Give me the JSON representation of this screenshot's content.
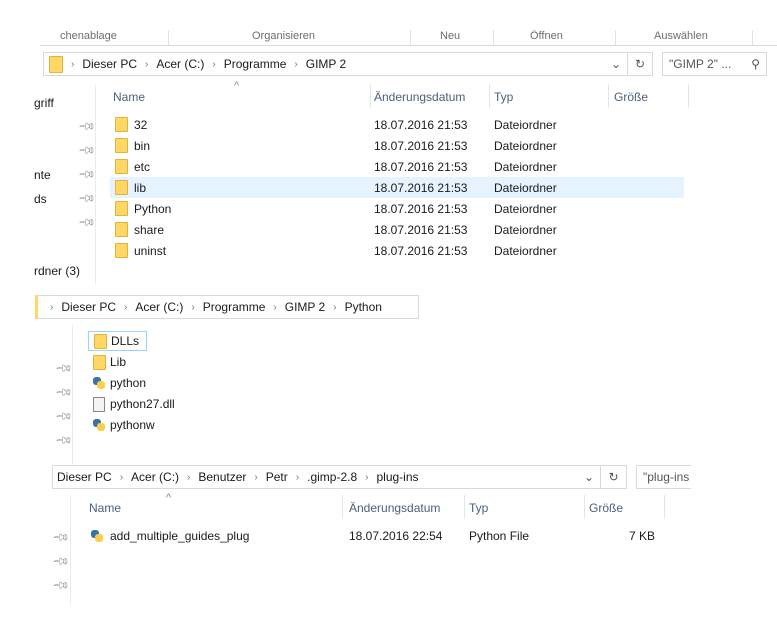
{
  "panel1": {
    "ribbon": [
      "chenablage",
      "Organisieren",
      "Neu",
      "Öffnen",
      "Auswählen"
    ],
    "breadcrumb": [
      "Dieser PC",
      "Acer (C:)",
      "Programme",
      "GIMP 2"
    ],
    "search_placeholder": "\"GIMP 2\" ...",
    "nav": [
      "griff",
      "nte",
      "ds",
      "rdner (3)"
    ],
    "columns": {
      "name": "Name",
      "date": "Änderungsdatum",
      "type": "Typ",
      "size": "Größe"
    },
    "rows": [
      {
        "name": "32",
        "date": "18.07.2016 21:53",
        "type": "Dateiordner"
      },
      {
        "name": "bin",
        "date": "18.07.2016 21:53",
        "type": "Dateiordner"
      },
      {
        "name": "etc",
        "date": "18.07.2016 21:53",
        "type": "Dateiordner"
      },
      {
        "name": "lib",
        "date": "18.07.2016 21:53",
        "type": "Dateiordner"
      },
      {
        "name": "Python",
        "date": "18.07.2016 21:53",
        "type": "Dateiordner"
      },
      {
        "name": "share",
        "date": "18.07.2016 21:53",
        "type": "Dateiordner"
      },
      {
        "name": "uninst",
        "date": "18.07.2016 21:53",
        "type": "Dateiordner"
      }
    ]
  },
  "panel2": {
    "breadcrumb": [
      "Dieser PC",
      "Acer (C:)",
      "Programme",
      "GIMP 2",
      "Python"
    ],
    "items": [
      {
        "name": "DLLs",
        "icon": "folder"
      },
      {
        "name": "Lib",
        "icon": "folder"
      },
      {
        "name": "python",
        "icon": "python"
      },
      {
        "name": "python27.dll",
        "icon": "dll"
      },
      {
        "name": "pythonw",
        "icon": "python"
      }
    ]
  },
  "panel3": {
    "breadcrumb": [
      "Dieser PC",
      "Acer (C:)",
      "Benutzer",
      "Petr",
      ".gimp-2.8",
      "plug-ins"
    ],
    "search_placeholder": "\"plug-ins",
    "columns": {
      "name": "Name",
      "date": "Änderungsdatum",
      "type": "Typ",
      "size": "Größe"
    },
    "rows": [
      {
        "name": "add_multiple_guides_plug",
        "date": "18.07.2016 22:54",
        "type": "Python File",
        "size": "7 KB"
      }
    ]
  }
}
